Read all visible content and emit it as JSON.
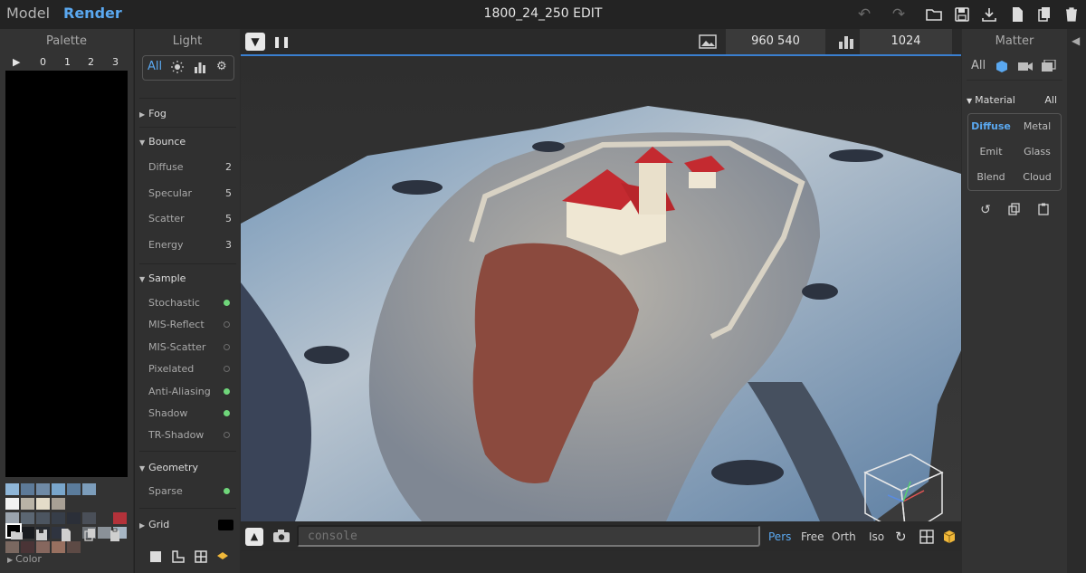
{
  "topbar": {
    "tab_model": "Model",
    "tab_render": "Render",
    "title": "1800_24_250 EDIT",
    "icons": [
      "undo-icon",
      "redo-icon",
      "folder-open-icon",
      "save-icon",
      "download-icon",
      "new-file-icon",
      "copy-file-icon",
      "trash-icon"
    ]
  },
  "palette": {
    "title": "Palette",
    "columns": [
      "0",
      "1",
      "2",
      "3"
    ],
    "selected_color": "#000000",
    "swatches": [
      "#8fb6d8",
      "#5d7a98",
      "#6f8aa6",
      "#79a6cc",
      "#5b7c9c",
      "#7c9dbb",
      "#f2f2f2",
      "#b9b3a6",
      "#e4dcc9",
      "#a8a095",
      "#9aa3ad",
      "#5b6672",
      "#4c5560",
      "#373e49",
      "#2b2f38",
      "#4a4f58",
      "#b3323a",
      "#000000",
      "#1a1c20",
      "#262a30",
      "#2f3440",
      "#6e7378",
      "#8a9198",
      "#a6b6c4",
      "#7a6860",
      "#4a3436",
      "#86675e",
      "#987060",
      "#5d4a45"
    ],
    "color_section": "Color"
  },
  "light": {
    "title": "Light",
    "tab_all": "All",
    "fog": "Fog",
    "bounce": {
      "title": "Bounce",
      "items": [
        {
          "label": "Diffuse",
          "value": "2"
        },
        {
          "label": "Specular",
          "value": "5"
        },
        {
          "label": "Scatter",
          "value": "5"
        },
        {
          "label": "Energy",
          "value": "3"
        }
      ]
    },
    "sample": {
      "title": "Sample",
      "items": [
        {
          "label": "Stochastic",
          "on": true
        },
        {
          "label": "MIS-Reflect",
          "on": false
        },
        {
          "label": "MIS-Scatter",
          "on": false
        },
        {
          "label": "Pixelated",
          "on": false
        },
        {
          "label": "Anti-Aliasing",
          "on": true
        },
        {
          "label": "Shadow",
          "on": true
        },
        {
          "label": "TR-Shadow",
          "on": false
        }
      ]
    },
    "geometry": {
      "title": "Geometry",
      "items": [
        {
          "label": "Sparse",
          "on": true
        }
      ]
    },
    "grid": "Grid"
  },
  "viewport": {
    "resolution": "960  540",
    "samples": "1024",
    "console_placeholder": "console",
    "cam_modes": [
      "Pers",
      "Free",
      "Orth",
      "Iso"
    ],
    "active_cam_mode": "Pers",
    "progress": 1.0
  },
  "matter": {
    "title": "Matter",
    "tab_all": "All",
    "material_label": "Material",
    "material_all": "All",
    "materials": [
      "Diffuse",
      "Metal",
      "Emit",
      "Glass",
      "Blend",
      "Cloud"
    ],
    "selected_material": "Diffuse"
  },
  "colors": {
    "accent": "#5aa8f0",
    "toggle_on": "#6fd67a",
    "roof_red": "#c42a30"
  }
}
